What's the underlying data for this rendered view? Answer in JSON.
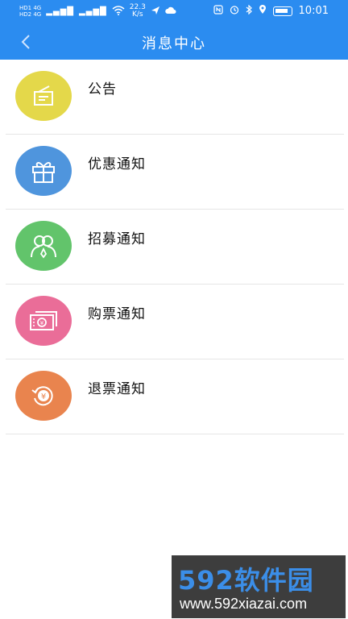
{
  "status_bar": {
    "left": [
      "HD1 4G",
      "HD2 4G"
    ],
    "network_speed_value": "22.3",
    "network_speed_unit": "K/s",
    "time": "10:01"
  },
  "header": {
    "title": "消息中心",
    "back_icon": "chevron-left-icon",
    "background": "#2b8cf0"
  },
  "messages": [
    {
      "label": "公告",
      "icon": "announcement-icon",
      "color": "#e4d84a"
    },
    {
      "label": "优惠通知",
      "icon": "gift-icon",
      "color": "#4f95dd"
    },
    {
      "label": "招募通知",
      "icon": "people-icon",
      "color": "#62c46b"
    },
    {
      "label": "购票通知",
      "icon": "ticket-icon",
      "color": "#ea6d98"
    },
    {
      "label": "退票通知",
      "icon": "refund-icon",
      "color": "#e9844e"
    }
  ],
  "watermark": {
    "top": "592软件园",
    "bottom": "www.592xiazai.com"
  }
}
